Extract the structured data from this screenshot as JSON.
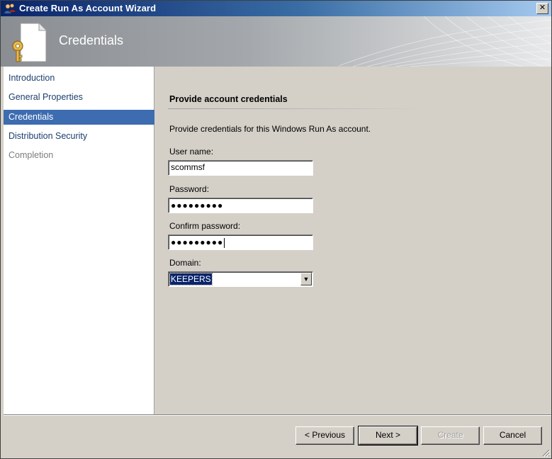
{
  "window": {
    "title": "Create Run As Account Wizard",
    "close_label": "✕"
  },
  "banner": {
    "title": "Credentials",
    "icon": "key-document-icon"
  },
  "nav": {
    "items": [
      {
        "label": "Introduction",
        "state": "normal"
      },
      {
        "label": "General Properties",
        "state": "normal"
      },
      {
        "label": "Credentials",
        "state": "selected"
      },
      {
        "label": "Distribution Security",
        "state": "normal"
      },
      {
        "label": "Completion",
        "state": "disabled"
      }
    ]
  },
  "content": {
    "section_title": "Provide account credentials",
    "description": "Provide credentials for this Windows Run As account.",
    "username": {
      "label": "User name:",
      "value": "scommsf"
    },
    "password": {
      "label": "Password:",
      "value": "●●●●●●●●●"
    },
    "confirm_password": {
      "label": "Confirm password:",
      "value": "●●●●●●●●●"
    },
    "domain": {
      "label": "Domain:",
      "value": "KEEPERS"
    }
  },
  "buttons": {
    "previous": "< Previous",
    "next": "Next >",
    "create": "Create",
    "cancel": "Cancel"
  },
  "colors": {
    "title_bar": "#0a246a",
    "nav_selected": "#3d6cb0",
    "dialog_face": "#d4d0c8"
  }
}
